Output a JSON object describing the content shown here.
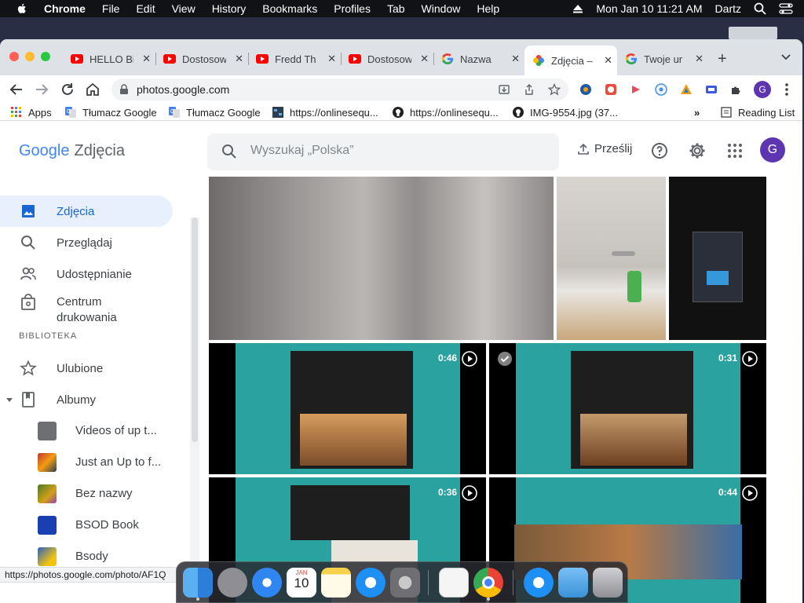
{
  "menubar": {
    "app": "Chrome",
    "items": [
      "File",
      "Edit",
      "View",
      "History",
      "Bookmarks",
      "Profiles",
      "Tab",
      "Window",
      "Help"
    ],
    "datetime": "Mon Jan 10  11:21 AM",
    "user": "Dartz"
  },
  "tabs": [
    {
      "title": "HELLO Bi",
      "icon": "youtube-icon"
    },
    {
      "title": "Dostosow",
      "icon": "youtube-icon"
    },
    {
      "title": "Fredd Th",
      "icon": "youtube-icon"
    },
    {
      "title": "Dostosow",
      "icon": "youtube-icon"
    },
    {
      "title": "Nazwa",
      "icon": "google-icon"
    },
    {
      "title": "Zdjęcia –",
      "icon": "google-photos-icon",
      "active": true
    },
    {
      "title": "Twoje ur",
      "icon": "google-icon"
    }
  ],
  "toolbar": {
    "url": "photos.google.com",
    "profile_initial": "G"
  },
  "bookmarks": {
    "items": [
      {
        "label": "Apps",
        "icon": "apps-grid-icon"
      },
      {
        "label": "Tłumacz Google",
        "icon": "google-translate-icon"
      },
      {
        "label": "Tłumacz Google",
        "icon": "google-translate-icon"
      },
      {
        "label": "https://onlinesequ...",
        "icon": "site-icon"
      },
      {
        "label": "https://onlinesequ...",
        "icon": "github-icon"
      },
      {
        "label": "IMG-9554.jpg (37...",
        "icon": "github-icon"
      }
    ],
    "overflow": "»",
    "reading_list": "Reading List"
  },
  "photos": {
    "logo_google": "Google",
    "logo_product": "Zdjęcia",
    "search_placeholder": "Wyszukaj „Polska”",
    "upload_label": "Prześlij",
    "avatar_initial": "G",
    "nav": [
      {
        "label": "Zdjęcia",
        "icon": "photo-icon",
        "active": true
      },
      {
        "label": "Przeglądaj",
        "icon": "search-icon"
      },
      {
        "label": "Udostępnianie",
        "icon": "people-icon"
      },
      {
        "label": "Centrum drukowania",
        "icon": "shopping-bag-icon"
      }
    ],
    "library_heading": "BIBLIOTEKA",
    "library": [
      {
        "label": "Ulubione",
        "icon": "star-icon"
      },
      {
        "label": "Albumy",
        "icon": "album-icon"
      }
    ],
    "albums": [
      {
        "label": "Videos of up t...",
        "color": "#6d6f73"
      },
      {
        "label": "Just an Up to f...",
        "color": "#c0392b"
      },
      {
        "label": "Bez nazwy",
        "color": "#4a7a2a"
      },
      {
        "label": "BSOD Book",
        "color": "#1a3fb0"
      },
      {
        "label": "Bsody",
        "color": "#2a60c0"
      }
    ],
    "grid": [
      {
        "kind": "photo",
        "desc": "blurry white surface"
      },
      {
        "kind": "photo",
        "desc": "bathroom faucet"
      },
      {
        "kind": "screenshot",
        "desc": "phone screenshot"
      },
      {
        "kind": "video",
        "duration": "0:46"
      },
      {
        "kind": "video",
        "duration": "0:31"
      },
      {
        "kind": "video",
        "duration": "0:36"
      },
      {
        "kind": "video",
        "duration": "0:44"
      }
    ]
  },
  "status_url": "https://photos.google.com/photo/AF1Q",
  "dock": [
    "finder",
    "launchpad",
    "safari",
    "calendar",
    "notes",
    "app-store",
    "system-preferences",
    "textedit",
    "chrome",
    "app-store-2",
    "folder",
    "trash"
  ],
  "dock_calendar": {
    "month": "JAN",
    "day": "10"
  },
  "colors": {
    "accent": "#1a73e8",
    "active_nav_bg": "#e8f0fe",
    "avatar": "#5e35b1"
  }
}
